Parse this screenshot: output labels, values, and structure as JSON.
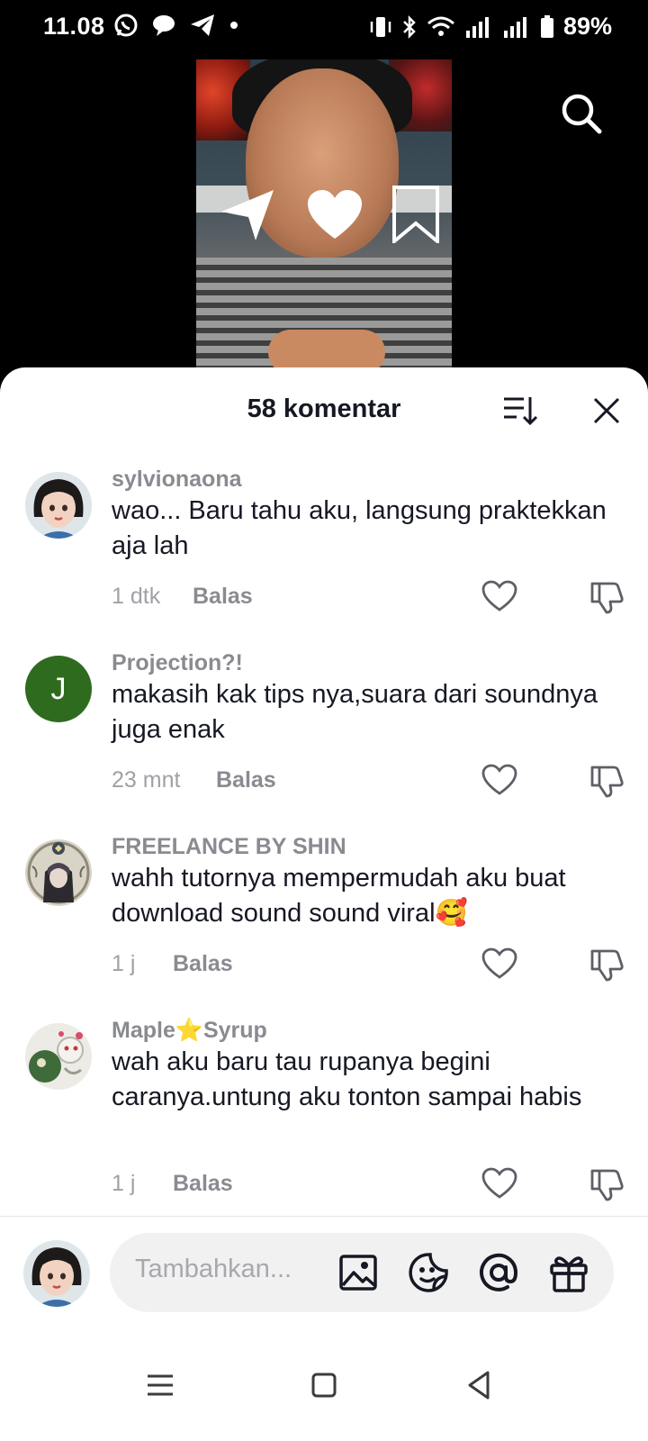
{
  "status_bar": {
    "time": "11.08",
    "battery": "89%"
  },
  "sheet": {
    "title": "58 komentar"
  },
  "comments": [
    {
      "username": "sylvionaona",
      "text": "wao... Baru tahu aku, langsung praktekkan aja lah",
      "time": "1 dtk",
      "reply": "Balas",
      "avatar": "girl-portrait"
    },
    {
      "username": "Projection?!",
      "text": "makasih kak tips nya,suara dari soundnya juga enak",
      "time": "23 mnt",
      "reply": "Balas",
      "avatar_letter": "J",
      "avatar_color": "#2e6b1f"
    },
    {
      "username": "FREELANCE BY SHIN",
      "text": "wahh tutornya mempermudah aku buat download sound sound viral🥰",
      "time": "1 j",
      "reply": "Balas",
      "avatar": "ornate-portrait"
    },
    {
      "username": "Maple⭐Syrup",
      "text": "wah aku baru tau rupanya begini caranya.untung aku tonton sampai habis",
      "time": "1 j",
      "reply": "Balas",
      "avatar": "illustration"
    }
  ],
  "input": {
    "placeholder": "Tambahkan..."
  },
  "icons": {
    "search": "search-icon",
    "sort": "sort-icon",
    "close": "close-icon",
    "like": "heart-outline-icon",
    "dislike": "thumbs-down-icon",
    "image": "image-icon",
    "emoji": "sticker-icon",
    "mention": "at-icon",
    "gift": "gift-icon"
  },
  "colors": {
    "text_primary": "#161823",
    "text_secondary": "#8a8b91",
    "sheet_bg": "#ffffff"
  }
}
